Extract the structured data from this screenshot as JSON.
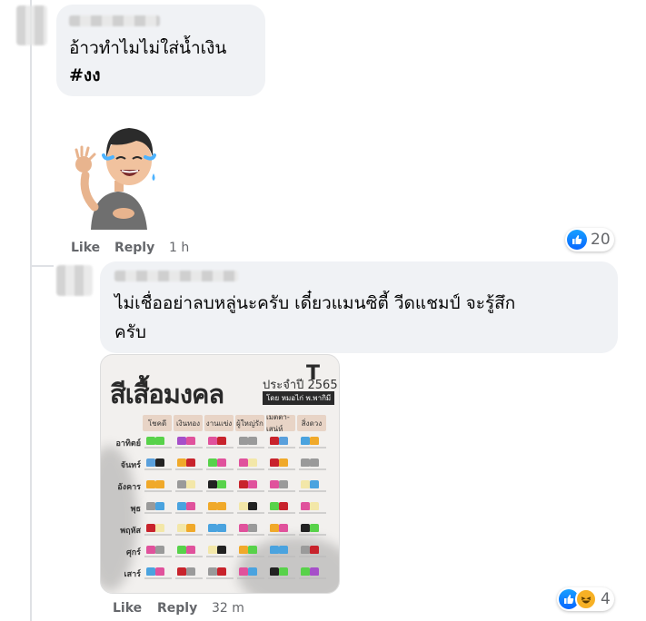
{
  "comment1": {
    "text_line1": "อ้าวทำไมไม่ใส่น้ำเงิน",
    "text_line2": "#งง",
    "like_label": "Like",
    "reply_label": "Reply",
    "time": "1 h",
    "reaction_count": "20",
    "sticker": "laughing-tears-sticker"
  },
  "comment2": {
    "text_line1": "ไม่เชื่ออย่าลบหลู่นะครับ เดี๋ยวแมนซิตี้ วีดแชมป์ จะรู้สึก",
    "text_line2": "ครับ",
    "like_label": "Like",
    "reply_label": "Reply",
    "time": "32 m",
    "reaction_count": "4"
  },
  "image": {
    "title": "สีเสื้อมงคล",
    "subtitle": "ประจำปี 2565",
    "by": "โดย หมอไก่ พ.พากิมี",
    "logo": "T",
    "columns": [
      "โชคดี",
      "เงินทอง",
      "งานแข่ง",
      "ผู้ใหญ่รัก",
      "เมตตา-เสน่ห์",
      "สิ่งดวง"
    ],
    "days": [
      "อาทิตย์",
      "จันทร์",
      "อังคาร",
      "พุธ",
      "พฤหัส",
      "ศุกร์",
      "เสาร์"
    ],
    "colors": [
      [
        "#58d24a",
        "#a64fc9",
        "#e0529c",
        "#9a9a9a",
        "#c8232c",
        "#4aa3df"
      ],
      [
        "#5aa0dc",
        "#f0a92a",
        "#58d24a",
        "#e0529c",
        "#c8232c",
        "#9a9a9a"
      ],
      [
        "#f0a92a",
        "#9a9a9a",
        "#222222",
        "#c8232c",
        "#e0529c",
        "#f3e7a8"
      ],
      [
        "#9a9a9a",
        "#4aa3df",
        "#f0a92a",
        "#f3e7a8",
        "#58d24a",
        "#e0529c"
      ],
      [
        "#c8232c",
        "#f3e7a8",
        "#4aa3df",
        "#e0529c",
        "#f0a92a",
        "#222222"
      ],
      [
        "#e0529c",
        "#58d24a",
        "#f3e7a8",
        "#f0a92a",
        "#4aa3df",
        "#9a9a9a"
      ],
      [
        "#4aa3df",
        "#c8232c",
        "#9a9a9a",
        "#e0529c",
        "#222222",
        "#58d24a"
      ]
    ]
  },
  "icons": {
    "like": "thumbs-up-icon",
    "haha": "laughing-face-icon"
  }
}
